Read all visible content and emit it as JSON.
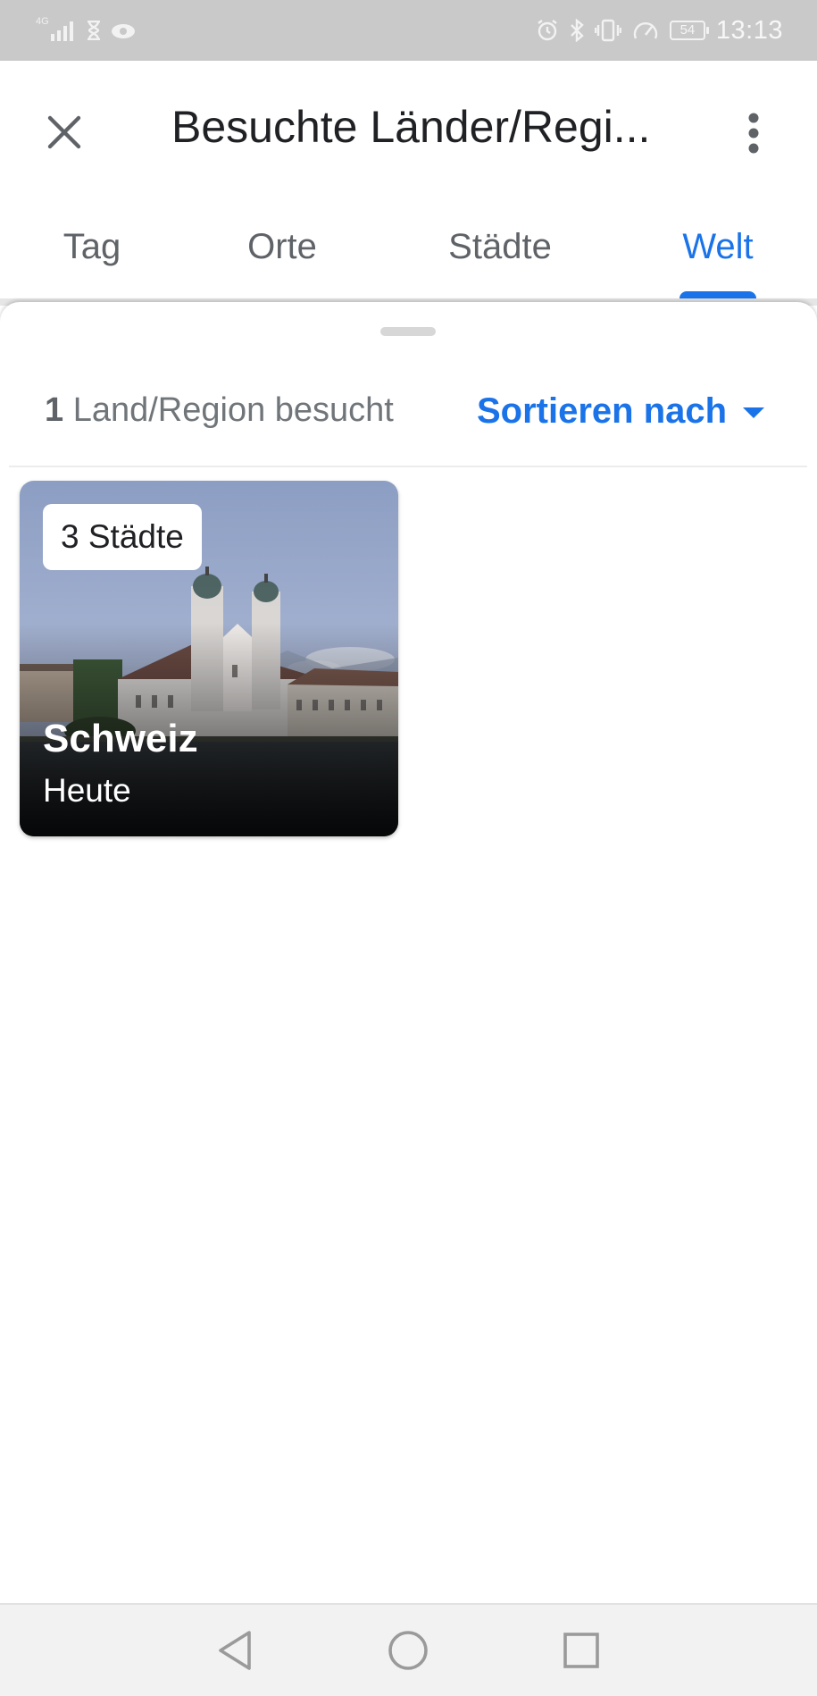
{
  "status_bar": {
    "network": "4G",
    "time": "13:13",
    "battery": "54",
    "icons": [
      "signal-icon",
      "hourglass-icon",
      "cloud-icon",
      "alarm-icon",
      "bluetooth-icon",
      "vibrate-icon",
      "speed-icon",
      "battery-icon"
    ]
  },
  "header": {
    "title": "Besuchte Länder/Regi...",
    "close_icon": "close-icon",
    "more_icon": "more-vert-icon"
  },
  "tabs": [
    {
      "label": "Tag",
      "active": false
    },
    {
      "label": "Orte",
      "active": false
    },
    {
      "label": "Städte",
      "active": false
    },
    {
      "label": "Welt",
      "active": true
    }
  ],
  "summary": {
    "count": "1",
    "text": "Land/Region besucht"
  },
  "sort": {
    "label": "Sortieren nach",
    "icon": "dropdown-caret-icon"
  },
  "countries": [
    {
      "badge": "3 Städte",
      "name": "Schweiz",
      "date": "Heute"
    }
  ],
  "colors": {
    "accent": "#1a73e8",
    "title": "#202124",
    "tab_inactive": "#5f6368",
    "status_bar": "#c9c9c9"
  },
  "nav_bar": {
    "icons": [
      "back-icon",
      "home-icon",
      "recents-icon"
    ]
  }
}
